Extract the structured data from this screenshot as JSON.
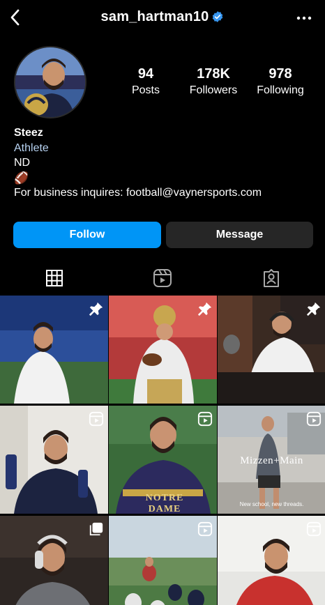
{
  "header": {
    "username": "sam_hartman10",
    "verified": true,
    "icons": {
      "back": "chevron-left-icon",
      "verified": "verified-badge-icon",
      "more": "more-dots-icon"
    }
  },
  "profile": {
    "stats": {
      "posts": {
        "value": "94",
        "label": "Posts"
      },
      "followers": {
        "value": "178K",
        "label": "Followers"
      },
      "following": {
        "value": "978",
        "label": "Following"
      }
    },
    "bio": {
      "name": "Steez",
      "category": "Athlete",
      "line1": "ND",
      "emoji": "🏈",
      "business": "For business inquires: football@vaynersports.com"
    }
  },
  "actions": {
    "follow": "Follow",
    "message": "Message"
  },
  "tabs": [
    {
      "name": "grid",
      "icon": "grid-icon",
      "active": true
    },
    {
      "name": "reels",
      "icon": "reels-icon",
      "active": false
    },
    {
      "name": "tagged",
      "icon": "tagged-icon",
      "active": false
    }
  ],
  "posts": [
    {
      "type": "photo",
      "badge": "pin-icon"
    },
    {
      "type": "photo",
      "badge": "pin-icon"
    },
    {
      "type": "photo",
      "badge": "pin-icon"
    },
    {
      "type": "reel",
      "badge": "reel-icon"
    },
    {
      "type": "reel",
      "badge": "reel-icon",
      "overlay": "NOTRE DAME"
    },
    {
      "type": "reel",
      "badge": "reel-icon",
      "overlay": "Mizzen+Main",
      "caption": "New school, new threads."
    },
    {
      "type": "carousel",
      "badge": "carousel-icon"
    },
    {
      "type": "reel",
      "badge": "reel-icon"
    },
    {
      "type": "reel",
      "badge": "reel-icon"
    }
  ],
  "colors": {
    "accent": "#0095f6",
    "secondary_button": "#262626",
    "category_text": "#b8d3f2",
    "background": "#000000"
  }
}
